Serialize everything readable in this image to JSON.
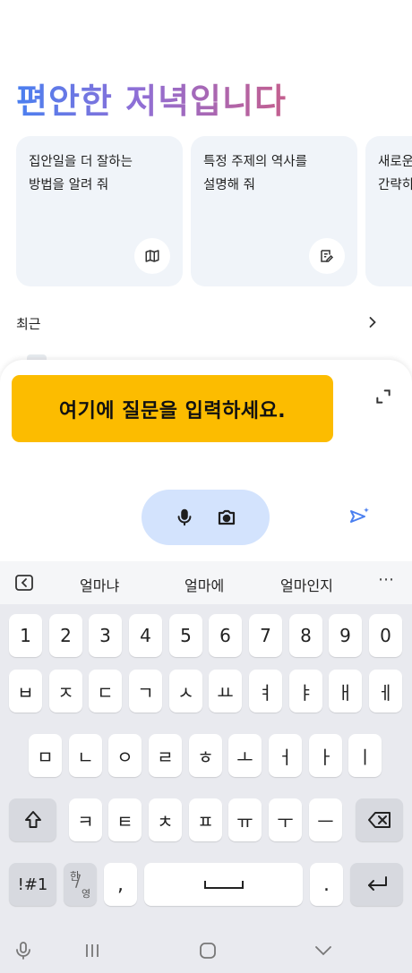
{
  "greeting": "편안한 저녁입니다",
  "cards": [
    {
      "text": "집안일을 더 잘하는\n방법을 알려 줘",
      "icon": "map-icon"
    },
    {
      "text": "특정 주제의 역사를\n설명해 줘",
      "icon": "edit-note-icon"
    },
    {
      "text": "새로운\n간략히",
      "icon": "none"
    }
  ],
  "recent": {
    "label": "최근"
  },
  "prompt": {
    "banner_text": "여기에 질문을 입력하세요."
  },
  "suggestions": {
    "words": [
      "얼마냐",
      "얼마에",
      "얼마인지"
    ],
    "more": "⋯"
  },
  "keyboard": {
    "numbers": [
      "1",
      "2",
      "3",
      "4",
      "5",
      "6",
      "7",
      "8",
      "9",
      "0"
    ],
    "row1": [
      "ㅂ",
      "ㅈ",
      "ㄷ",
      "ㄱ",
      "ㅅ",
      "ㅛ",
      "ㅕ",
      "ㅑ",
      "ㅐ",
      "ㅔ"
    ],
    "row2": [
      "ㅁ",
      "ㄴ",
      "ㅇ",
      "ㄹ",
      "ㅎ",
      "ㅗ",
      "ㅓ",
      "ㅏ",
      "ㅣ"
    ],
    "row3": [
      "ㅋ",
      "ㅌ",
      "ㅊ",
      "ㅍ",
      "ㅠ",
      "ㅜ",
      "ㅡ"
    ],
    "symbols_label": "!#1",
    "lang_top": "한",
    "lang_bottom": "영",
    "comma": ",",
    "period": "."
  },
  "colors": {
    "accent": "#4a7ff0",
    "banner": "#fcbc00",
    "pill": "#d3e3fd",
    "keyboard_bg": "#e9eaef"
  }
}
